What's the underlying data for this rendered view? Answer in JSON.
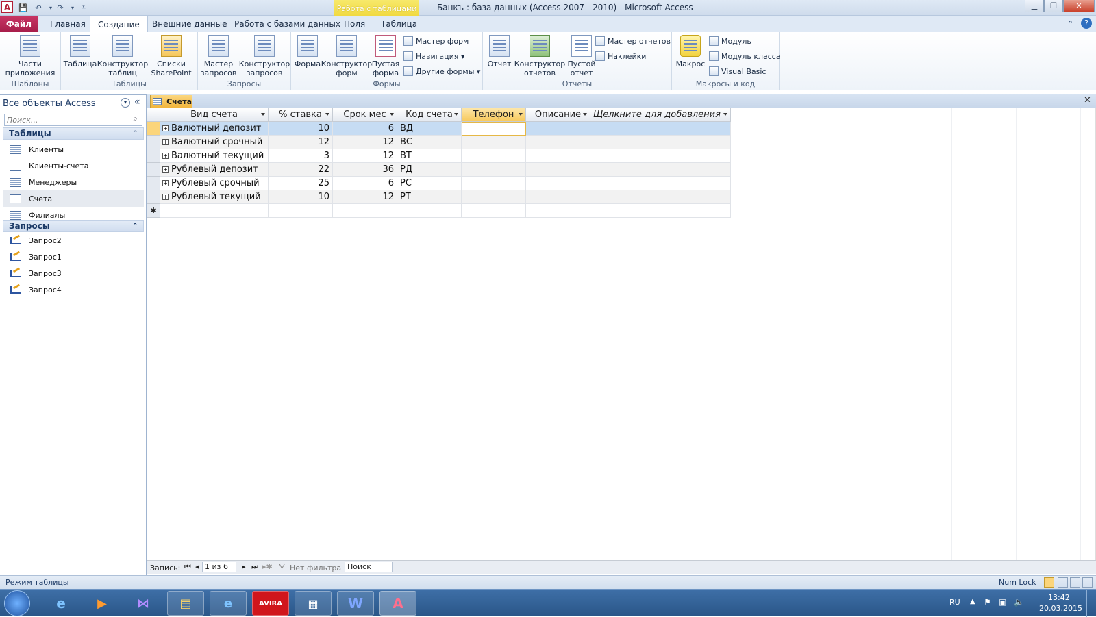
{
  "window": {
    "title": "Банкъ : база данных (Access 2007 - 2010)  -  Microsoft Access",
    "context_group": "Работа с таблицами"
  },
  "tabs": {
    "file": "Файл",
    "items": [
      "Главная",
      "Создание",
      "Внешние данные",
      "Работа с базами данных",
      "Поля",
      "Таблица"
    ],
    "active": "Создание"
  },
  "ribbon": {
    "templates": {
      "label": "Шаблоны",
      "parts": "Части приложения"
    },
    "tables": {
      "label": "Таблицы",
      "table": "Таблица",
      "designer": "Конструктор таблиц",
      "sharepoint": "Списки SharePoint"
    },
    "queries": {
      "label": "Запросы",
      "wizard": "Мастер запросов",
      "designer": "Конструктор запросов"
    },
    "forms": {
      "label": "Формы",
      "form": "Форма",
      "designer": "Конструктор форм",
      "blank": "Пустая форма",
      "wizard": "Мастер форм",
      "navigation": "Навигация",
      "other": "Другие формы"
    },
    "reports": {
      "label": "Отчеты",
      "report": "Отчет",
      "designer": "Конструктор отчетов",
      "blank": "Пустой отчет",
      "wizard": "Мастер отчетов",
      "labels": "Наклейки"
    },
    "macros": {
      "label": "Макросы и код",
      "macro": "Макрос",
      "module": "Модуль",
      "class_module": "Модуль класса",
      "vb": "Visual Basic"
    }
  },
  "nav": {
    "header": "Все объекты Access",
    "search_placeholder": "Поиск...",
    "tables_header": "Таблицы",
    "tables": [
      "Клиенты",
      "Клиенты-счета",
      "Менеджеры",
      "Счета",
      "Филиалы"
    ],
    "selected_table": "Счета",
    "queries_header": "Запросы",
    "queries": [
      "Запрос2",
      "Запрос1",
      "Запрос3",
      "Запрос4"
    ]
  },
  "document": {
    "tab": "Счета",
    "columns": [
      "Вид счета",
      "% ставка",
      "Срок мес",
      "Код счета",
      "Телефон",
      "Описание",
      "Щелкните для добавления"
    ],
    "rows": [
      [
        "Валютный депозит",
        "10",
        "6",
        "ВД",
        "",
        ""
      ],
      [
        "Валютный срочный",
        "12",
        "12",
        "ВС",
        "",
        ""
      ],
      [
        "Валютный текущий",
        "3",
        "12",
        "ВТ",
        "",
        ""
      ],
      [
        "Рублевый депозит",
        "22",
        "36",
        "РД",
        "",
        ""
      ],
      [
        "Рублевый срочный",
        "25",
        "6",
        "РС",
        "",
        ""
      ],
      [
        "Рублевый текущий",
        "10",
        "12",
        "РТ",
        "",
        ""
      ]
    ]
  },
  "record_nav": {
    "label": "Запись:",
    "position": "1 из 6",
    "filter": "Нет фильтра",
    "search": "Поиск"
  },
  "status": {
    "mode": "Режим таблицы",
    "numlock": "Num Lock"
  },
  "taskbar": {
    "lang": "RU",
    "time": "13:42",
    "date": "20.03.2015",
    "avira": "AVIRA"
  },
  "colors": {
    "access_accent": "#a81e4b",
    "selection": "#fbd57b",
    "context_tab": "#f0d83e"
  }
}
